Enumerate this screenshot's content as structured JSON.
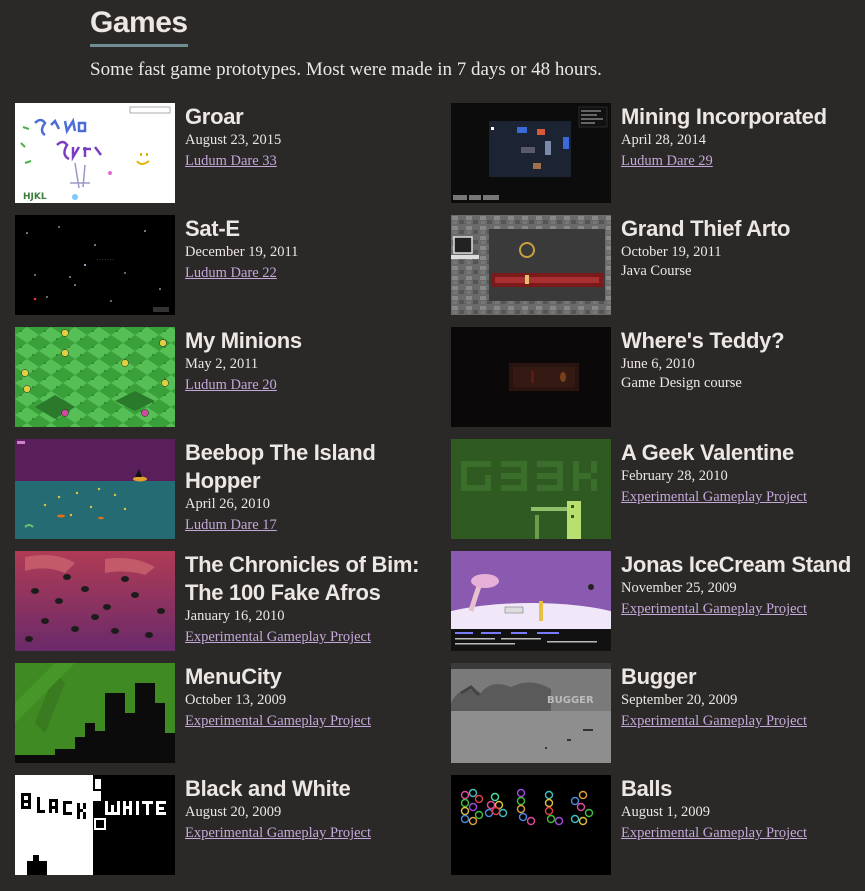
{
  "page": {
    "title": "Games",
    "subtitle": "Some fast game prototypes. Most were made in 7 days or 48 hours."
  },
  "games": [
    {
      "title": "Groar",
      "date": "August 23, 2015",
      "event": "Ludum Dare 33",
      "event_is_link": true
    },
    {
      "title": "Mining Incorporated",
      "date": "April 28, 2014",
      "event": "Ludum Dare 29",
      "event_is_link": true
    },
    {
      "title": "Sat-E",
      "date": "December 19, 2011",
      "event": "Ludum Dare 22",
      "event_is_link": true
    },
    {
      "title": "Grand Thief Arto",
      "date": "October 19, 2011",
      "event": "Java Course",
      "event_is_link": false
    },
    {
      "title": "My Minions",
      "date": "May 2, 2011",
      "event": "Ludum Dare 20",
      "event_is_link": true
    },
    {
      "title": "Where's Teddy?",
      "date": "June 6, 2010",
      "event": "Game Design course",
      "event_is_link": false
    },
    {
      "title": "Beebop The Island Hopper",
      "date": "April 26, 2010",
      "event": "Ludum Dare 17",
      "event_is_link": true
    },
    {
      "title": "A Geek Valentine",
      "date": "February 28, 2010",
      "event": "Experimental Gameplay Project",
      "event_is_link": true
    },
    {
      "title": "The Chronicles of Bim: The 100 Fake Afros",
      "date": "January 16, 2010",
      "event": "Experimental Gameplay Project",
      "event_is_link": true
    },
    {
      "title": "Jonas IceCream Stand",
      "date": "November 25, 2009",
      "event": "Experimental Gameplay Project",
      "event_is_link": true
    },
    {
      "title": "MenuCity",
      "date": "October 13, 2009",
      "event": "Experimental Gameplay Project",
      "event_is_link": true
    },
    {
      "title": "Bugger",
      "date": "September 20, 2009",
      "event": "Experimental Gameplay Project",
      "event_is_link": true
    },
    {
      "title": "Black and White",
      "date": "August 20, 2009",
      "event": "Experimental Gameplay Project",
      "event_is_link": true
    },
    {
      "title": "Balls",
      "date": "August 1, 2009",
      "event": "Experimental Gameplay Project",
      "event_is_link": true
    }
  ],
  "colors": {
    "background": "#2b2828",
    "text": "#ece7e2",
    "link": "#c3a8d8",
    "title_underline": "#6f8f92"
  },
  "thumbnail_icons": [
    "groar-thumbnail",
    "mining-thumbnail",
    "sate-thumbnail",
    "arto-thumbnail",
    "minions-thumbnail",
    "teddy-thumbnail",
    "beebop-thumbnail",
    "geek-thumbnail",
    "bim-thumbnail",
    "icecream-thumbnail",
    "menucity-thumbnail",
    "bugger-thumbnail",
    "blackwhite-thumbnail",
    "balls-thumbnail"
  ]
}
